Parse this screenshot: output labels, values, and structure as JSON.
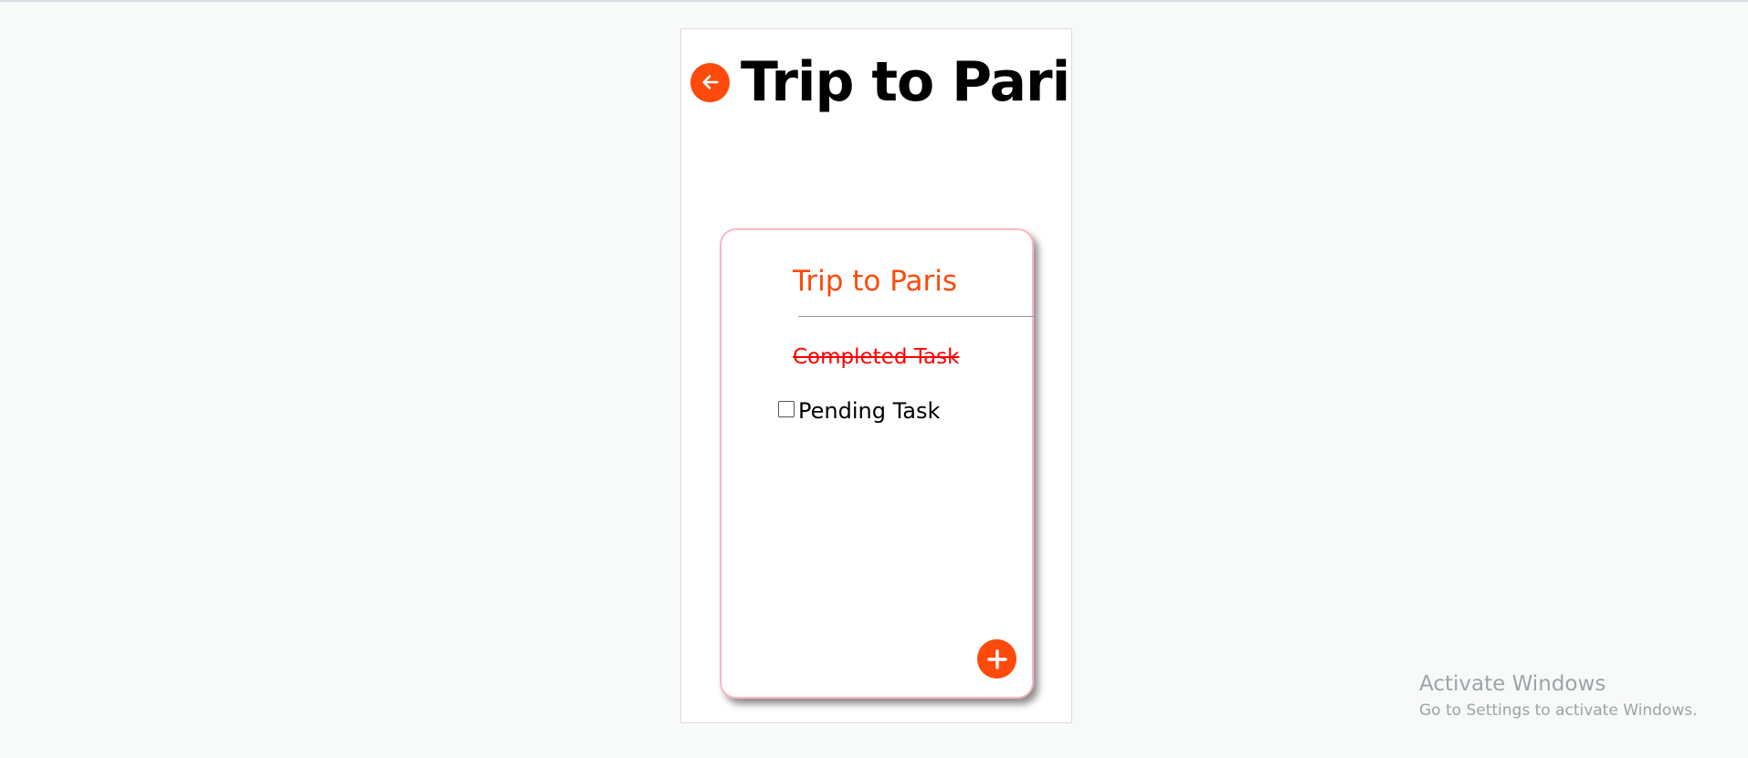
{
  "header": {
    "title": "Trip to Paris",
    "back_icon": "arrow-left-icon"
  },
  "card": {
    "title": "Trip to Paris",
    "tasks": [
      {
        "label": "Completed Task",
        "completed": true
      },
      {
        "label": "Pending Task",
        "completed": false
      }
    ],
    "add_icon": "plus-icon"
  },
  "colors": {
    "accent": "#fd4a0b",
    "completed_text": "#ff0000",
    "card_border": "#ffb6c1"
  },
  "system": {
    "activate_title": "Activate Windows",
    "activate_sub": "Go to Settings to activate Windows."
  }
}
